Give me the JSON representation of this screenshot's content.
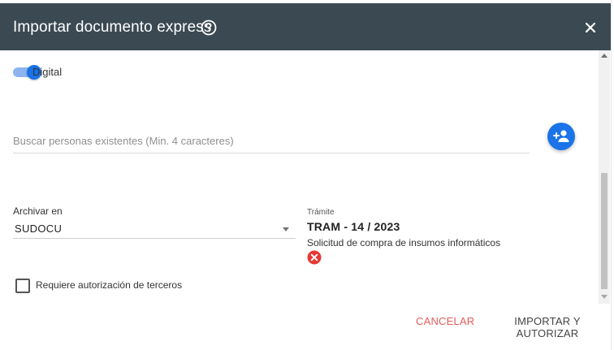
{
  "dialog": {
    "title": "Importar documento express",
    "help_icon": "help-circle-icon",
    "close_icon": "close-icon"
  },
  "toggle": {
    "label": "Digital",
    "checked": true
  },
  "search": {
    "placeholder": "Buscar personas existentes (Min. 4 caracteres)",
    "value": "",
    "add_icon": "add-person-icon"
  },
  "archive": {
    "label": "Archivar en",
    "value": "SUDOCU"
  },
  "tramite": {
    "label": "Trámite",
    "code": "TRAM - 14 / 2023",
    "description": "Solicitud de compra de insumos informáticos",
    "remove_icon": "remove-circle-icon"
  },
  "authorization": {
    "label": "Requiere autorización de terceros",
    "checked": false
  },
  "actions": {
    "cancel_label": "CANCELAR",
    "import_label": "IMPORTAR Y AUTORIZAR"
  },
  "colors": {
    "header_bg": "#3b4a52",
    "accent": "#1a73e8",
    "cancel": "#e45b5b",
    "remove": "#e53935"
  }
}
